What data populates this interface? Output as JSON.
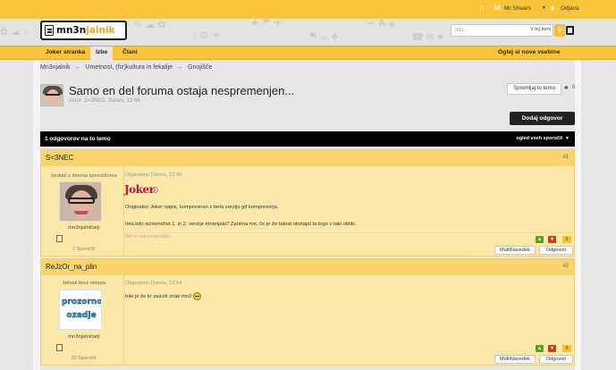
{
  "topbar": {
    "user": "Mr Shears",
    "logout": "Odjava"
  },
  "logo": {
    "part1": "mn3n",
    "part2": "jalnik"
  },
  "search": {
    "placeholder": "Išči...",
    "scope": "V tej temi"
  },
  "nav": {
    "items": [
      "Joker stranka",
      "Izbe",
      "Člani"
    ],
    "new_posts": "Oglej si nove vsebine"
  },
  "breadcrumb": [
    "Mn3njalnik",
    "Umetnost, (fiz)kultura in fekalije",
    "Gnojišče"
  ],
  "thread": {
    "title": "Samo en del foruma ostaja nespremenjen...",
    "meta": "Avtor: S<3NEC, Danes, 12:46",
    "watch_label": "Spremljaj to temo",
    "likes": "0",
    "reply_label": "Dodaj odgovor"
  },
  "replies_bar": {
    "count_label": "1 odgovorov na to temo",
    "view_all": "ogled vseh sporočil"
  },
  "posts": [
    {
      "username": "S<3NEC",
      "number": "#1",
      "rank": "bednik z dvema sporočiloma",
      "handle": "mn3njalničarji",
      "post_count": "2 Sporočil:",
      "date": "Objavljeno Danes, 12:46",
      "image_text": "Joker",
      "lines": [
        "Originalen Joker napis, kompresiran z beta verzijo gif kompresorja.",
        "Ima kdo screenshot 1. in 2. verzije mnenjala? Zanima me, če je že takrat obstajal ta logo v taki obliki."
      ],
      "signature": "We're not compatible.",
      "score": "0",
      "multiquote": "MultiNavedek",
      "reply": "Odgovori"
    },
    {
      "username": "ReJzOr_na_plin",
      "number": "#2",
      "rank": "želvak brez oklepa",
      "handle": "mn3njalničarji",
      "post_count": "20 Sporočil:",
      "date": "Objavljeno Danes, 12:54",
      "avatar_text_1": "prozorno",
      "avatar_text_2": "ozadje",
      "lines": [
        "tole je že kr zasciti znak mn3"
      ],
      "score": "0",
      "multiquote": "MultiNavedek",
      "reply": "Odgovori"
    }
  ],
  "colors": {
    "accent": "#f8c53a",
    "post_bg": "#fbe8a8",
    "post_header": "#f8d46b",
    "vote_up": "#57a022",
    "vote_down": "#d23a22"
  },
  "icons": [
    "home-icon",
    "mail-icon",
    "bell-icon",
    "search-icon",
    "likes-icon",
    "arrow-up-icon",
    "arrow-down-icon",
    "pm-icon",
    "smiley-icon"
  ]
}
